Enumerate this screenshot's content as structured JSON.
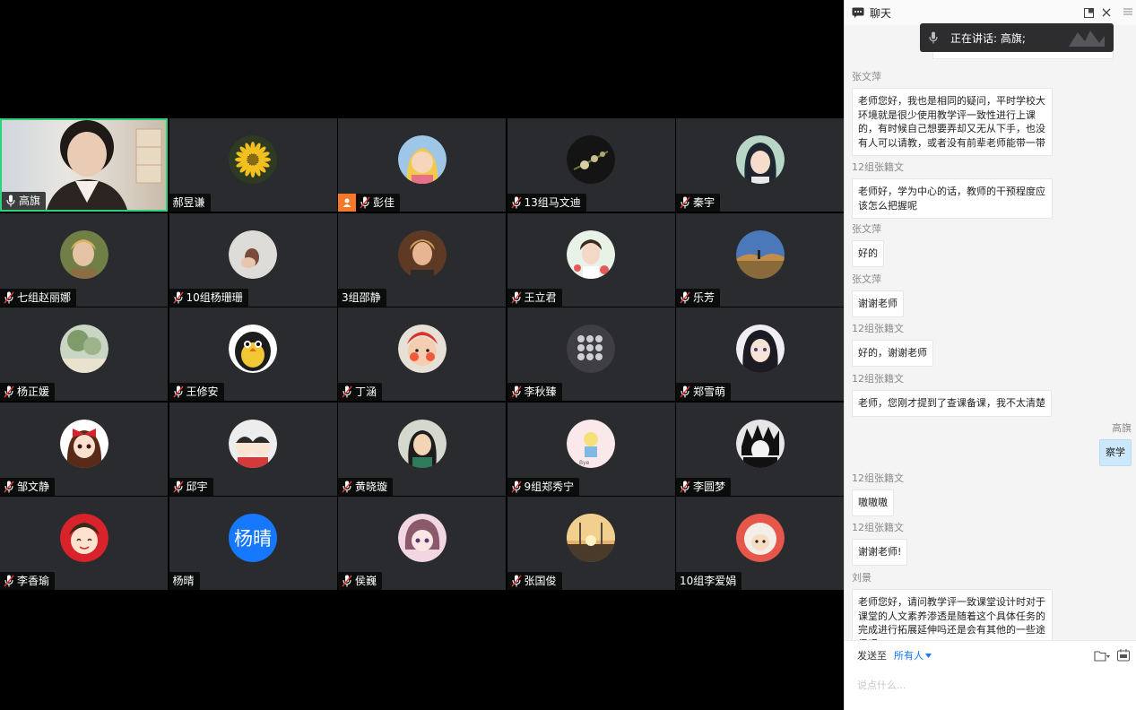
{
  "participants": [
    {
      "name": "高旗",
      "avatar": "webcam",
      "active": true,
      "mic": "on"
    },
    {
      "name": "郝昱谦",
      "avatar": "flower-photo",
      "mic": "none"
    },
    {
      "name": "彭佳",
      "avatar": "cartoon-girl",
      "mic": "muted",
      "host": true
    },
    {
      "name": "13组马文迪",
      "avatar": "flower-dark",
      "mic": "muted"
    },
    {
      "name": "秦宇",
      "avatar": "anime-girl",
      "mic": "muted"
    },
    {
      "name": "七组赵丽娜",
      "avatar": "portrait",
      "mic": "muted"
    },
    {
      "name": "10组杨珊珊",
      "avatar": "hands",
      "mic": "muted"
    },
    {
      "name": "3组邵静",
      "avatar": "woman-photo",
      "mic": "none"
    },
    {
      "name": "王立君",
      "avatar": "girl-flowers",
      "mic": "muted"
    },
    {
      "name": "乐芳",
      "avatar": "landscape",
      "mic": "muted"
    },
    {
      "name": "杨正媛",
      "avatar": "tree",
      "mic": "muted"
    },
    {
      "name": "王修安",
      "avatar": "penguin",
      "mic": "muted"
    },
    {
      "name": "丁涵",
      "avatar": "baby",
      "mic": "muted"
    },
    {
      "name": "李秋臻",
      "avatar": "blossom",
      "mic": "muted"
    },
    {
      "name": "郑雪萌",
      "avatar": "anime-dark",
      "mic": "muted"
    },
    {
      "name": "邹文静",
      "avatar": "cartoon-bow",
      "mic": "muted"
    },
    {
      "name": "邱宇",
      "avatar": "cartoon-kids",
      "mic": "muted"
    },
    {
      "name": "黄晓璇",
      "avatar": "mulan",
      "mic": "muted"
    },
    {
      "name": "9组郑秀宁",
      "avatar": "drawing",
      "mic": "muted"
    },
    {
      "name": "李圆梦",
      "avatar": "manga",
      "mic": "muted"
    },
    {
      "name": "李香瑜",
      "avatar": "cartoon-red",
      "mic": "muted"
    },
    {
      "name": "杨晴",
      "avatar": "text",
      "avatar_text": "杨晴",
      "mic": "none"
    },
    {
      "name": "侯巍",
      "avatar": "anime-pink",
      "mic": "muted"
    },
    {
      "name": "张国俊",
      "avatar": "sunset",
      "mic": "muted"
    },
    {
      "name": "10组李爱娟",
      "avatar": "sheep",
      "mic": "none"
    }
  ],
  "chat": {
    "title": "聊天",
    "speaking_label": "正在讲话: 高旗;",
    "messages": [
      {
        "sender": "张文萍",
        "text": "老师您好，我也是相同的疑问，平时学校大环境就是很少使用教学评一致性进行上课的，有时候自己想要弄却又无从下手，也没有人可以请教，或者没有前辈老师能带一带"
      },
      {
        "sender": "12组张籍文",
        "text": "老师好，学为中心的话，教师的干预程度应该怎么把握呢"
      },
      {
        "sender": "张文萍",
        "text": "好的"
      },
      {
        "sender": "张文萍",
        "text": "谢谢老师"
      },
      {
        "sender": "12组张籍文",
        "text": "好的，谢谢老师"
      },
      {
        "sender": "12组张籍文",
        "text": "老师，您刚才提到了查课备课，我不太清楚"
      },
      {
        "sender": "高旗",
        "text": "察学",
        "self": true
      },
      {
        "sender": "12组张籍文",
        "text": "嗷嗷嗷"
      },
      {
        "sender": "12组张籍文",
        "text": "谢谢老师!"
      },
      {
        "sender": "刘景",
        "text": "老师您好，请问教学评一致课堂设计时对于课堂的人文素养渗透是随着这个具体任务的完成进行拓展延伸吗还是会有其他的一些途径呢?"
      }
    ],
    "send_to_label": "发送至",
    "send_target": "所有人",
    "input_placeholder": "说点什么...",
    "accent_color": "#1677ff"
  }
}
